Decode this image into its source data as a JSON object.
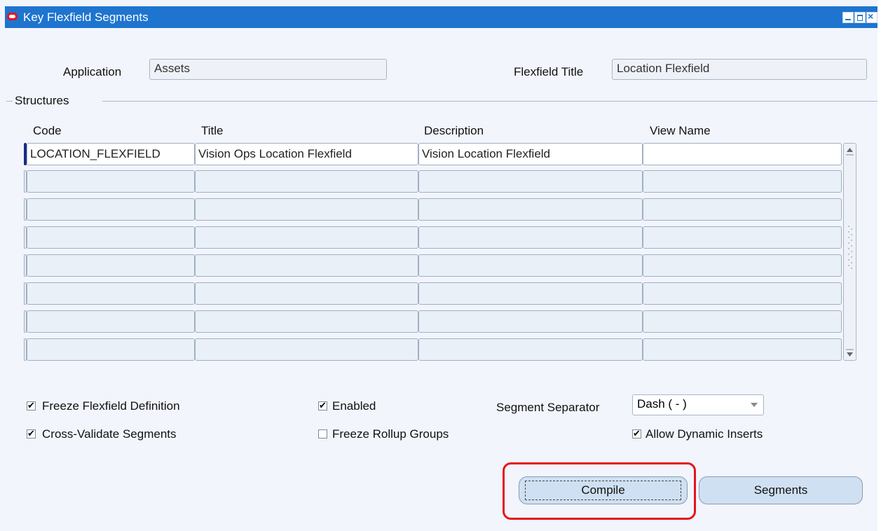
{
  "window": {
    "title": "Key Flexfield Segments"
  },
  "header": {
    "application_label": "Application",
    "application_value": "Assets",
    "flexfield_title_label": "Flexfield Title",
    "flexfield_title_value": "Location Flexfield"
  },
  "structures": {
    "section_label": "Structures",
    "columns": [
      "Code",
      "Title",
      "Description",
      "View Name"
    ],
    "rows": [
      {
        "code": "LOCATION_FLEXFIELD",
        "title": "Vision Ops Location Flexfield",
        "description": "Vision Location Flexfield",
        "view_name": ""
      },
      {
        "code": "",
        "title": "",
        "description": "",
        "view_name": ""
      },
      {
        "code": "",
        "title": "",
        "description": "",
        "view_name": ""
      },
      {
        "code": "",
        "title": "",
        "description": "",
        "view_name": ""
      },
      {
        "code": "",
        "title": "",
        "description": "",
        "view_name": ""
      },
      {
        "code": "",
        "title": "",
        "description": "",
        "view_name": ""
      },
      {
        "code": "",
        "title": "",
        "description": "",
        "view_name": ""
      },
      {
        "code": "",
        "title": "",
        "description": "",
        "view_name": ""
      }
    ]
  },
  "options": {
    "freeze_flexfield_definition": {
      "label": "Freeze Flexfield Definition",
      "checked": true
    },
    "cross_validate_segments": {
      "label": "Cross-Validate Segments",
      "checked": true
    },
    "enabled": {
      "label": "Enabled",
      "checked": true
    },
    "freeze_rollup_groups": {
      "label": "Freeze Rollup Groups",
      "checked": false
    },
    "segment_separator_label": "Segment Separator",
    "segment_separator_value": "Dash ( - )",
    "allow_dynamic_inserts": {
      "label": "Allow Dynamic Inserts",
      "checked": true
    }
  },
  "buttons": {
    "compile": "Compile",
    "segments": "Segments"
  },
  "colors": {
    "titlebar": "#1e74cf",
    "highlight": "#e3151e",
    "current_row": "#1a2c8a"
  }
}
